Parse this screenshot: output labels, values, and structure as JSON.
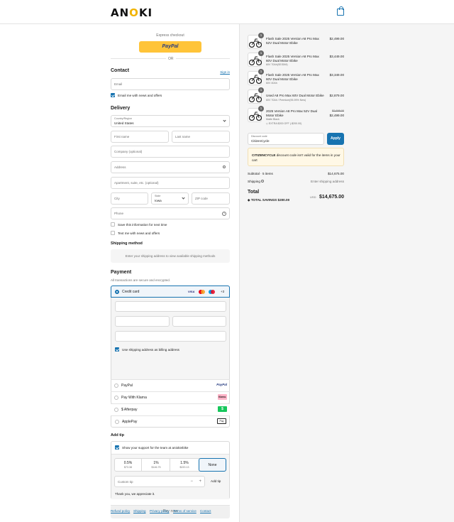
{
  "header": {
    "logo": "ANOKI",
    "logo_prefix": "AN",
    "logo_o": "O",
    "logo_suffix": "KI",
    "bag_icon": "shopping-bag-icon"
  },
  "express": {
    "label": "Express checkout",
    "paypal": "PayPal",
    "or": "OR"
  },
  "contact": {
    "title": "Contact",
    "sign_in": "Sign in",
    "email_placeholder": "Email",
    "news_label": "Email me with news and offers",
    "news_checked": true
  },
  "delivery": {
    "title": "Delivery",
    "country_label": "Country/Region",
    "country_value": "United States",
    "first_name": "First name",
    "last_name": "Last name",
    "company": "Company (optional)",
    "address": "Address",
    "apartment": "Apartment, suite, etc. (optional)",
    "city": "City",
    "state_label": "State",
    "state_value": "Iowa",
    "zip": "ZIP code",
    "phone": "Phone",
    "save_info": "Save this information for next time",
    "text_news": "Text me with news and offers"
  },
  "shipping_method": {
    "title": "Shipping method",
    "notice": "Enter your shipping address to view available shipping methods"
  },
  "payment": {
    "title": "Payment",
    "subtitle": "All transactions are secure and encrypted.",
    "credit_card": "Credit card",
    "more_cards": "+3",
    "visa": "VISA",
    "billing_same": "Use shipping address as billing address",
    "options": [
      {
        "label": "PayPal",
        "badge": "PayPal"
      },
      {
        "label": "Pay With Klarna",
        "badge": "Klarna."
      },
      {
        "label": "$ Afterpay",
        "badge": "$"
      },
      {
        "label": "ApplePay",
        "badge": "Pay"
      }
    ]
  },
  "tip": {
    "title": "Add tip",
    "support": "Show your support for the team at aniokiebike",
    "options": [
      {
        "pct": "0.5%",
        "amt": "$73.38"
      },
      {
        "pct": "1%",
        "amt": "$146.75"
      },
      {
        "pct": "1.5%",
        "amt": "$220.13"
      },
      {
        "pct": "None",
        "amt": ""
      }
    ],
    "custom_placeholder": "Custom tip",
    "minus": "−",
    "plus": "+",
    "add_button": "Add tip",
    "thanks": "Thank you, we appreciate it."
  },
  "pay_button": "Pay now",
  "footer_links": [
    "Refund policy",
    "Shipping",
    "Privacy policy",
    "Terms of service",
    "Contact"
  ],
  "cart": {
    "items": [
      {
        "qty": "1",
        "title1": "Flash Sale 2025 Version A8 Pro Max",
        "title2": "52V Dual Motor Ebike",
        "variant": "",
        "price": "$2,499.00",
        "old": ""
      },
      {
        "qty": "1",
        "title1": "Flash Sale 2025 Version A8 Pro Max",
        "title2": "60V Dual Motor Ebike",
        "variant": "60V 70Ah(SE/DIM)",
        "price": "$3,449.00",
        "old": ""
      },
      {
        "qty": "1",
        "title1": "Flash Sale 2025 Version A8 Pro Max",
        "title2": "60V Dual Motor Ebike",
        "variant": "60V 40Ah",
        "price": "$3,349.00",
        "old": ""
      },
      {
        "qty": "1",
        "title1": "Used A8 Pro Max 60V Dual Motor Ebike",
        "title2": "",
        "variant": "60V 70Ah / Premium(95-99% New)",
        "price": "$2,879.00",
        "old": ""
      },
      {
        "qty": "1",
        "title1": "2025 Version A8 Pro Max 52V Dual",
        "title2": "Motor Ebike",
        "variant": "Matte Black",
        "discount": "EXTRA $200 OFF (-$200.00)",
        "price": "$2,499.00",
        "old": "$2,699.00"
      }
    ],
    "discount_label": "Discount code",
    "discount_value": "CitizenCycle",
    "apply": "Apply",
    "error_code": "CITIZENCYCLE",
    "error_text": " discount code isn't valid for the items in your cart",
    "subtotal_label": "Subtotal · 5 items",
    "subtotal_value": "$14,675.00",
    "shipping_label": "Shipping",
    "shipping_value": "Enter shipping address",
    "total_label": "Total",
    "total_currency": "USD",
    "total_value": "$14,675.00",
    "savings_label": "TOTAL SAVINGS",
    "savings_value": "$200.00"
  },
  "colors": {
    "accent": "#1773b0",
    "paypal": "#ffc439",
    "error_bg": "#fff8e6"
  }
}
